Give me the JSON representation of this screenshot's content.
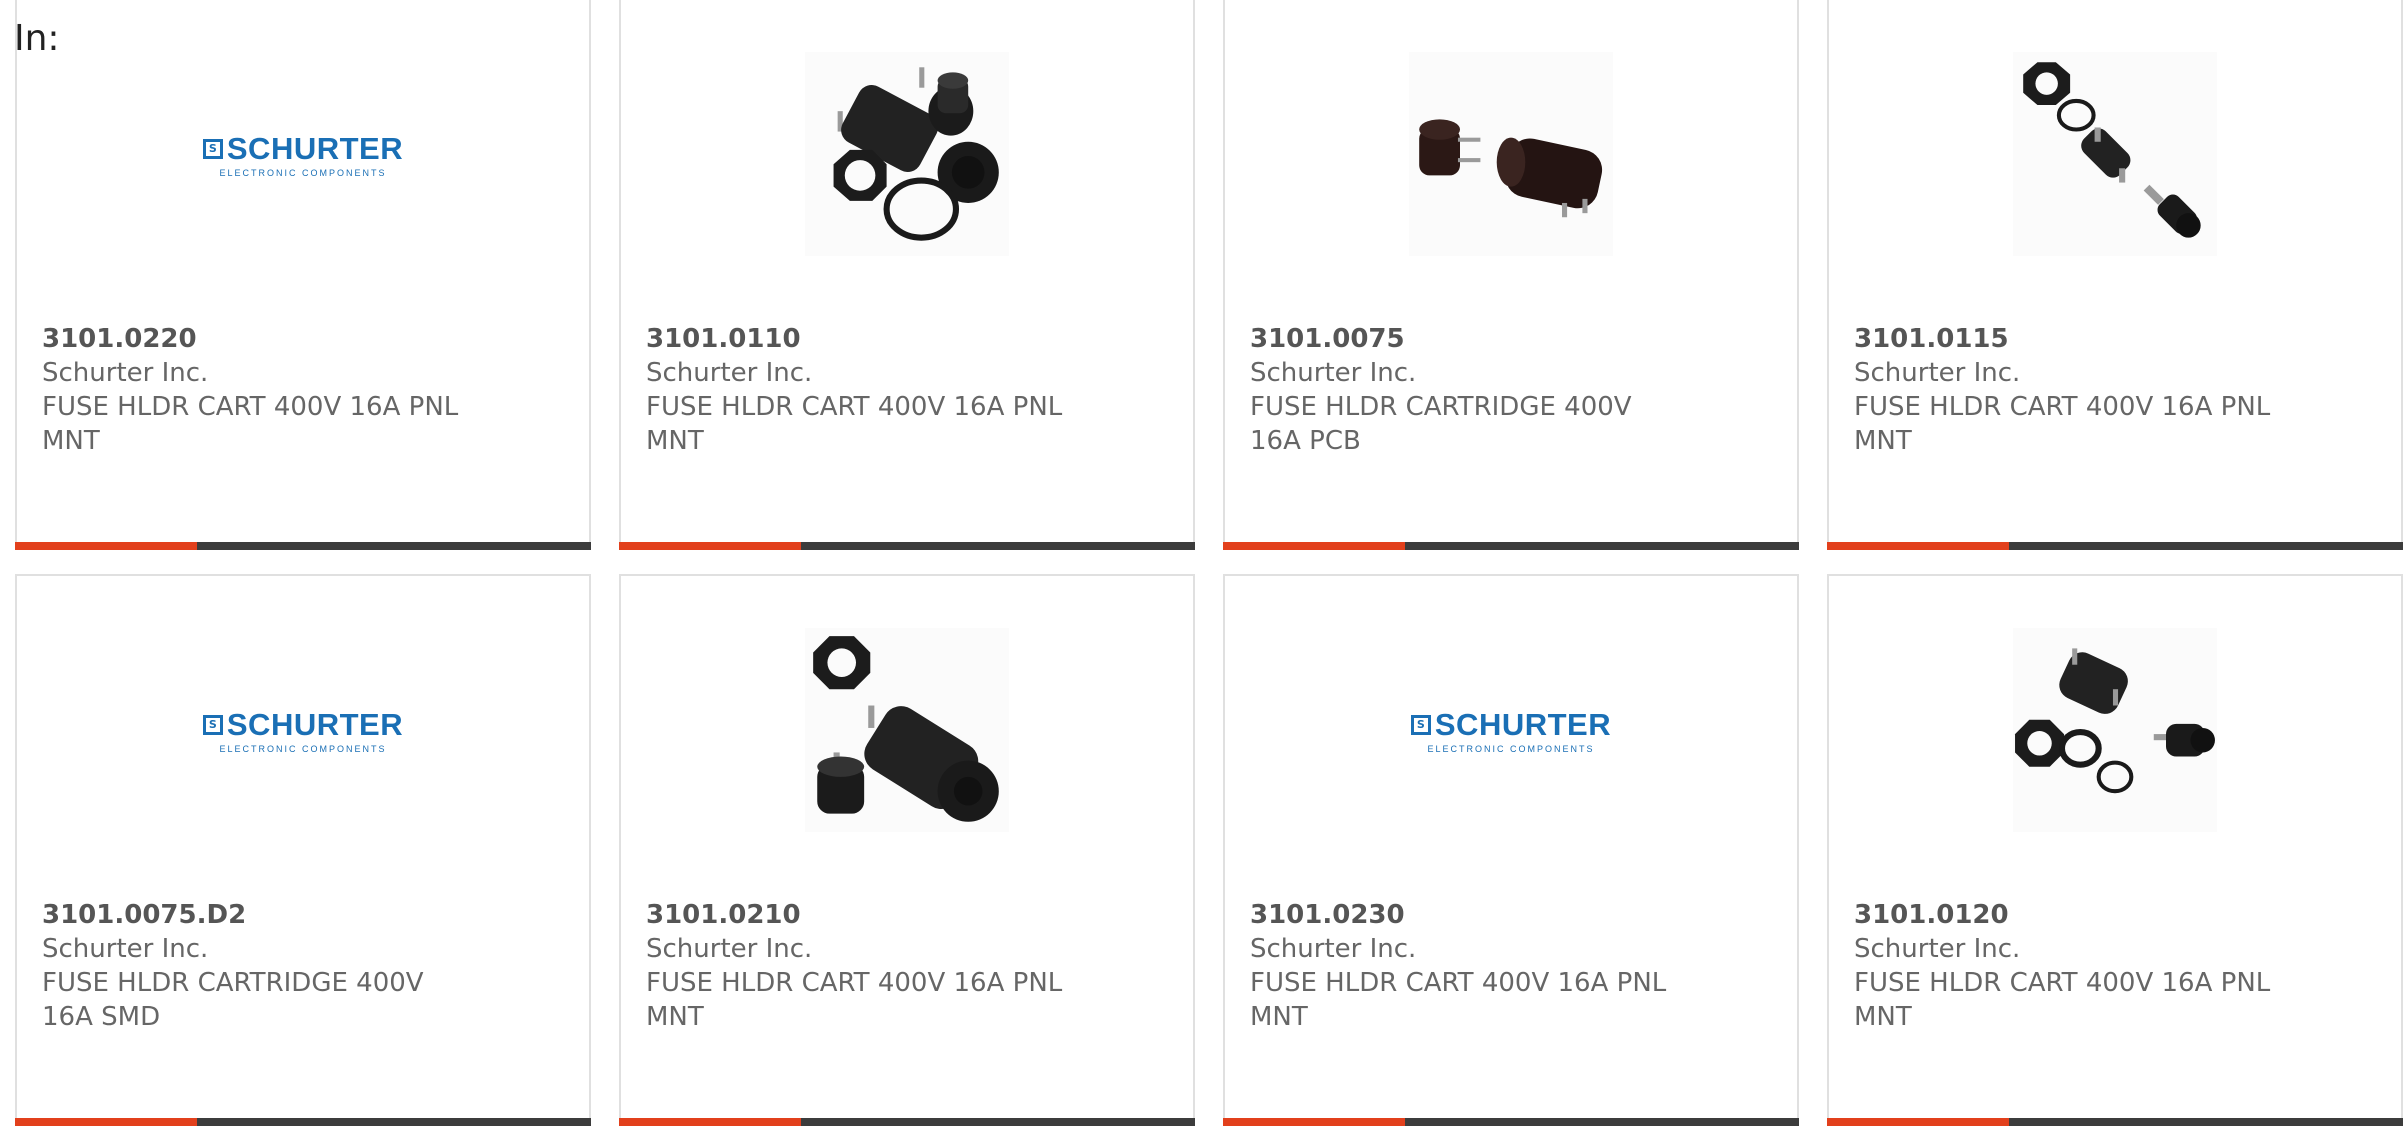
{
  "prefix": "In:",
  "logo": {
    "brand": "SCHURTER",
    "box_letter": "S",
    "tagline": "ELECTRONIC COMPONENTS"
  },
  "colors": {
    "accent": "#e2401c",
    "bar": "#3c3c3c",
    "brand_blue": "#1a6fb5",
    "text": "#666666"
  },
  "products": [
    {
      "part": "3101.0220",
      "manufacturer": "Schurter Inc.",
      "desc1": "FUSE HLDR CART 400V 16A PNL",
      "desc2": "MNT",
      "image": "schurter-logo"
    },
    {
      "part": "3101.0110",
      "manufacturer": "Schurter Inc.",
      "desc1": "FUSE HLDR CART 400V 16A PNL",
      "desc2": "MNT",
      "image": "fuse-holder-panel-photo"
    },
    {
      "part": "3101.0075",
      "manufacturer": "Schurter Inc.",
      "desc1": "FUSE HLDR CARTRIDGE 400V",
      "desc2": "16A PCB",
      "image": "fuse-holder-pcb-photo"
    },
    {
      "part": "3101.0115",
      "manufacturer": "Schurter Inc.",
      "desc1": "FUSE HLDR CART 400V 16A PNL",
      "desc2": "MNT",
      "image": "fuse-holder-exploded-photo"
    },
    {
      "part": "3101.0075.D2",
      "manufacturer": "Schurter Inc.",
      "desc1": "FUSE HLDR CARTRIDGE 400V",
      "desc2": "16A SMD",
      "image": "schurter-logo"
    },
    {
      "part": "3101.0210",
      "manufacturer": "Schurter Inc.",
      "desc1": "FUSE HLDR CART 400V 16A PNL",
      "desc2": "MNT",
      "image": "fuse-holder-panel-photo"
    },
    {
      "part": "3101.0230",
      "manufacturer": "Schurter Inc.",
      "desc1": "FUSE HLDR CART 400V 16A PNL",
      "desc2": "MNT",
      "image": "schurter-logo"
    },
    {
      "part": "3101.0120",
      "manufacturer": "Schurter Inc.",
      "desc1": "FUSE HLDR CART 400V 16A PNL",
      "desc2": "MNT",
      "image": "fuse-holder-rings-photo"
    }
  ]
}
